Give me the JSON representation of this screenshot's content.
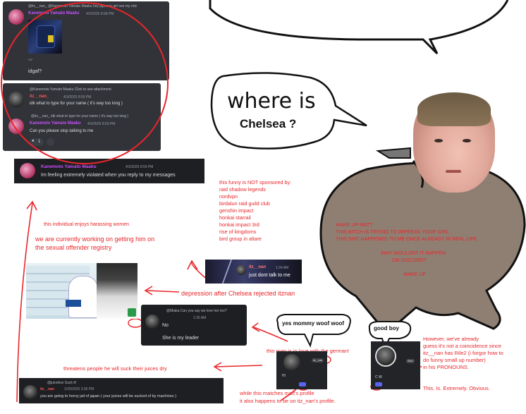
{
  "discord_top": {
    "reply_line": "@itz__nan_ @Kanemoto Yamato Maaku hey japnese girl see my role",
    "author": "Kanemoto Yamato Maaku",
    "timestamp": "4/3/2025 8:58 PM",
    "gif_badge": "GIF",
    "message": "idgaf?"
  },
  "discord_mid": {
    "reply_line_1": "@Kanemoto Yamato Maaku Click to see attachment",
    "author_1": "itz__nan_",
    "timestamp_1": "4/3/2025 8:59 PM",
    "message_1": "idk what to type for your name ( it's way too long )",
    "reply_line_2": "@itz__nan_ idk what to type for your name ( it's way too long )",
    "author_2": "Kanemoto Yamato Maaku",
    "timestamp_2": "4/3/2025 8:59 PM",
    "message_2": "Can you please stop talking to me",
    "reaction_count": "1"
  },
  "discord_violated": {
    "author": "Kanemoto Yamato Maaku",
    "timestamp": "4/3/2025 8:59 PM",
    "message": "Im feeling extremely violated when you reply to my messages"
  },
  "bubble_where": {
    "line1": "where is",
    "line2": "Chelsea ?"
  },
  "sponsor": {
    "heading": "this funny is NOT sponsored by:",
    "items": [
      "raid shadow legends",
      "nordvpn",
      "birdalun raid guild club",
      "genshin impact",
      "honkai starrail",
      "honkai impact 3rd",
      "rise of kingdoms",
      "bird group in altare"
    ]
  },
  "notes": {
    "harassing": "this individual enjoys harassing women",
    "registry_1": "we are currently working on getting him on",
    "registry_2": "the sexual offender registry",
    "depression": "depression after Chelsea rejected itznan",
    "threatens": "threatens people he will suck their juices dry",
    "german": "this man is in love with the german!",
    "profile_1": "while this matches matt's profile",
    "profile_2": "it also happens to be on itz_nan's profile.",
    "obvious": "This. Is. Extremely. Obvious.",
    "however_1": "However, we've already",
    "however_2": "guess it's not a coincidence since",
    "however_3": "itz__nan has Rile2 (i forgor how to",
    "however_4": "do funny small up number)",
    "however_5": "in his PRONOUNS."
  },
  "wake_up": {
    "l1": "WAKE UP MATT",
    "l2": "THIS BITCH IS TRYING TO IMPRESS YOUR GIRL",
    "l3": "THIS SHIT HAPPENED TO ME ONCE ALREADY IN REAL LIFE",
    "l4": "WHY WOULDNT IT HAPPEN",
    "l5": "ON DISCORD?",
    "l6": "WAKE UP"
  },
  "depression_card": {
    "author": "itz__nan",
    "timestamp": "1:34 AM",
    "message": "just dont talk to me"
  },
  "no_card": {
    "reply": "@Miaka Can you say we love her too?",
    "timestamp": "1:36 AM",
    "message_1": "No",
    "message_2": "She is my leader"
  },
  "bubbles": {
    "woof": "yes mommy woof woof",
    "goodboy": "good boy"
  },
  "bottom_card": {
    "reply": "@juicebox Suck it!",
    "author": "itz__nan",
    "timestamp": "1/25/2025 3:36 PM",
    "message": "you are going to horny jail of japan ( your juices will be sucked of by machines )"
  },
  "profile_left": {
    "tag": "Hi",
    "pill": "itz__nan"
  },
  "profile_right": {
    "pill": "Rile2",
    "tag": "C W"
  }
}
